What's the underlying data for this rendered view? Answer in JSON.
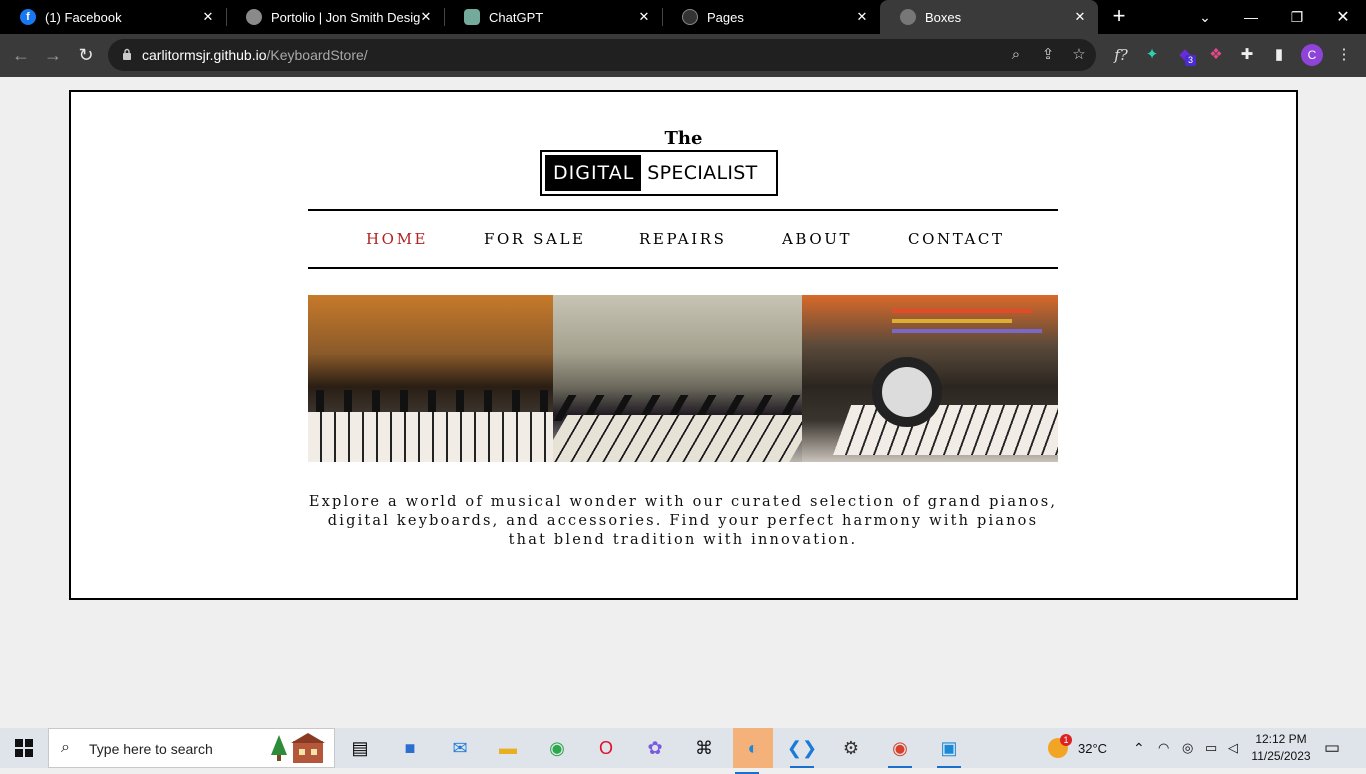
{
  "browser": {
    "tabs": [
      {
        "label": "(1) Facebook",
        "favicon": "facebook-icon",
        "active": false
      },
      {
        "label": "Portolio | Jon Smith Designs",
        "favicon": "globe-icon",
        "active": false
      },
      {
        "label": "ChatGPT",
        "favicon": "chatgpt-icon",
        "active": false
      },
      {
        "label": "Pages",
        "favicon": "github-icon",
        "active": false
      },
      {
        "label": "Boxes",
        "favicon": "globe-icon",
        "active": true
      }
    ],
    "url_host": "carlitormsjr.github.io",
    "url_path": "/KeyboardStore/",
    "profile_initial": "C",
    "extension_badge": "3"
  },
  "site": {
    "logo_top": "The",
    "logo_left": "DIGITAL",
    "logo_right": "SPECIALIST",
    "nav": [
      {
        "label": "HOME",
        "current": true
      },
      {
        "label": "FOR SALE",
        "current": false
      },
      {
        "label": "REPAIRS",
        "current": false
      },
      {
        "label": "ABOUT",
        "current": false
      },
      {
        "label": "CONTACT",
        "current": false
      }
    ],
    "description": "Explore a world of musical wonder with our curated selection of grand pianos, digital keyboards, and accessories. Find your perfect harmony with pianos that blend tradition with innovation.",
    "accent_color": "#b22222"
  },
  "taskbar": {
    "search_placeholder": "Type here to search",
    "weather": "32°C",
    "weather_badge": "1",
    "time": "12:12 PM",
    "date": "11/25/2023"
  }
}
